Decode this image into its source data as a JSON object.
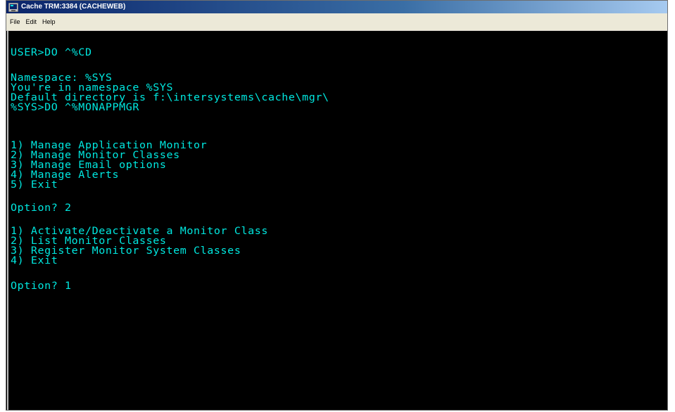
{
  "window": {
    "title": "Cache TRM:3384 (CACHEWEB)"
  },
  "menu": {
    "items": [
      "File",
      "Edit",
      "Help"
    ]
  },
  "terminal": {
    "lines": [
      "USER>DO ^%CD",
      "Namespace: %SYS",
      "You're in namespace %SYS",
      "Default directory is f:\\intersystems\\cache\\mgr\\",
      "%SYS>DO ^%MONAPPMGR",
      "1) Manage Application Monitor",
      "2) Manage Monitor Classes",
      "3) Manage Email options",
      "4) Manage Alerts",
      "5) Exit",
      "Option? 2",
      "1) Activate/Deactivate a Monitor Class",
      "2) List Monitor Classes",
      "3) Register Monitor System Classes",
      "4) Exit",
      "Option? 1"
    ]
  },
  "colors": {
    "terminal_text": "#00e8e0",
    "terminal_bg": "#000000",
    "titlebar": "#0a246a"
  }
}
